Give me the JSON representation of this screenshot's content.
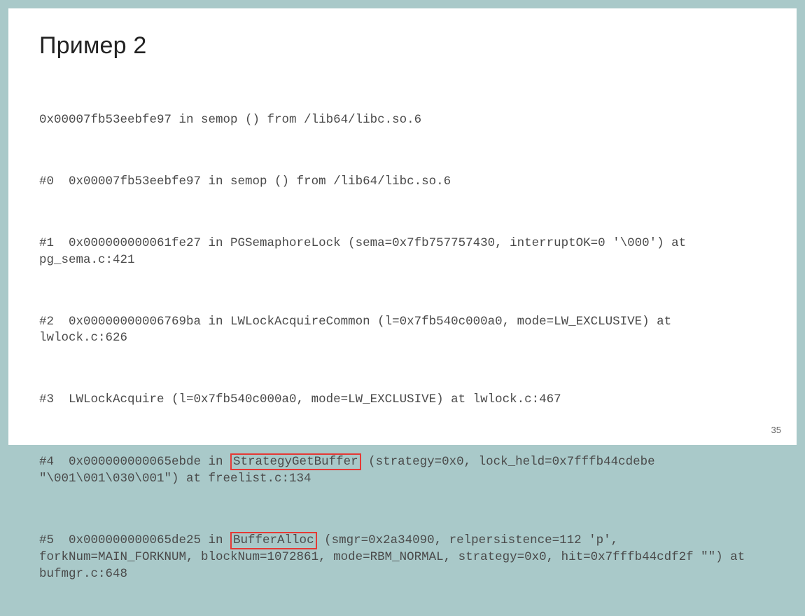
{
  "slide": {
    "title": "Пример 2",
    "page_number": "35",
    "bt": {
      "l0": "0x00007fb53eebfe97 in semop () from /lib64/libc.so.6",
      "l1": "#0  0x00007fb53eebfe97 in semop () from /lib64/libc.so.6",
      "l2": "#1  0x000000000061fe27 in PGSemaphoreLock (sema=0x7fb757757430, interruptOK=0 '\\000') at pg_sema.c:421",
      "l3": "#2  0x00000000006769ba in LWLockAcquireCommon (l=0x7fb540c000a0, mode=LW_EXCLUSIVE) at lwlock.c:626",
      "l4": "#3  LWLockAcquire (l=0x7fb540c000a0, mode=LW_EXCLUSIVE) at lwlock.c:467",
      "l5a": "#4  0x000000000065ebde in ",
      "l5h": "StrategyGetBuffer",
      "l5b": " (strategy=0x0, lock_held=0x7fffb44cdebe \"\\001\\001\\030\\001\") at freelist.c:134",
      "l6a": "#5  0x000000000065de25 in ",
      "l6h": "BufferAlloc",
      "l6b": " (smgr=0x2a34090, relpersistence=112 'p', forkNum=MAIN_FORKNUM, blockNum=1072861, mode=RBM_NORMAL, strategy=0x0, hit=0x7fffb44cdf2f \"\") at bufmgr.c:648"
    }
  }
}
